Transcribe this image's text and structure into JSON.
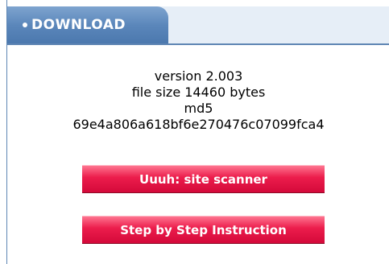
{
  "panel": {
    "title": "DOWNLOAD",
    "bullet_icon": "bullet-icon",
    "header_color": "#5a86ba"
  },
  "file_info": {
    "version": "version 2.003",
    "size": "file size 14460 bytes",
    "md5_label": "md5",
    "md5_hash": "69e4a806a618bf6e270476c07099fca4"
  },
  "buttons": {
    "scanner_label": "Uuuh: site scanner",
    "instructions_label": "Step by Step Instruction",
    "button_color": "#ec1d4c"
  }
}
